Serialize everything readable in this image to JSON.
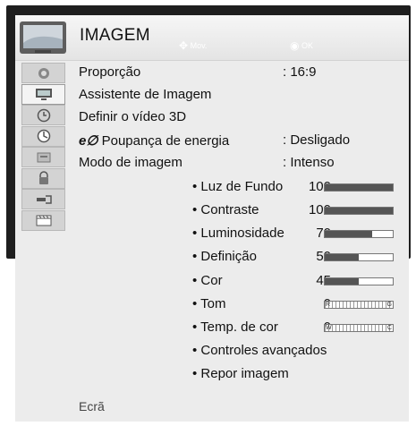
{
  "header": {
    "title": "IMAGEM",
    "hint_move": "Mov.",
    "hint_ok": "OK"
  },
  "sidebar": {
    "icons": [
      "picture-icon",
      "monitor-icon",
      "clock-icon",
      "timer-icon",
      "option-icon",
      "lock-icon",
      "input-icon",
      "usb-media-icon"
    ],
    "active_index": 1
  },
  "menu": {
    "items": [
      {
        "label": "Proporção",
        "value": ": 16:9"
      },
      {
        "label": "Assistente de Imagem",
        "value": ""
      },
      {
        "label": "Definir o vídeo 3D",
        "value": ""
      },
      {
        "label": "Poupança de energia",
        "value": ": Desligado",
        "prefix_icon": "eco-icon"
      },
      {
        "label": "Modo de imagem",
        "value": ": Intenso"
      }
    ],
    "sub_items": [
      {
        "label": "• Luz de Fundo",
        "value": "100",
        "level": 1.0,
        "bar": "fill"
      },
      {
        "label": "• Contraste",
        "value": "100",
        "level": 1.0,
        "bar": "fill"
      },
      {
        "label": "• Luminosidade",
        "value": "70",
        "level": 0.7,
        "bar": "fill"
      },
      {
        "label": "• Definição",
        "value": "50",
        "level": 0.5,
        "bar": "fill"
      },
      {
        "label": "• Cor",
        "value": "45",
        "level": 0.5,
        "bar": "fill"
      },
      {
        "label": "• Tom",
        "value": "0",
        "bar": "center",
        "left_mark": "R",
        "right_mark": "G"
      },
      {
        "label": "• Temp. de cor",
        "value": "0",
        "bar": "center",
        "left_mark": "W",
        "right_mark": "C"
      },
      {
        "label": "• Controles avançados",
        "value": ""
      },
      {
        "label": "• Repor imagem",
        "value": ""
      }
    ]
  },
  "footer": {
    "label": "Ecrã"
  },
  "colors": {
    "frame": "#1e1e1e",
    "panel": "#ececec",
    "bar_fill": "#555555"
  }
}
